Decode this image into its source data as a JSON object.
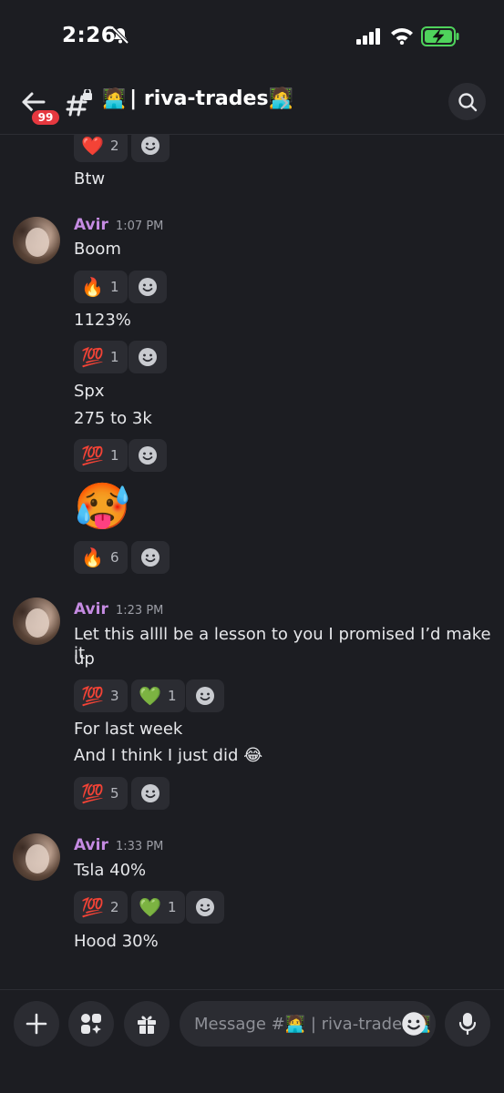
{
  "status_bar": {
    "time": "2:26"
  },
  "header": {
    "unread_count": "99",
    "channel_emoji": "🧑‍💻",
    "channel_name": "| riva-trades🧑‍💻"
  },
  "messages": {
    "pre": {
      "reaction": {
        "emoji": "❤️",
        "count": "2"
      },
      "text": "Btw"
    },
    "group1": {
      "author": "Avir",
      "time": "1:07 PM",
      "lines": [
        "Boom",
        "1123%",
        "Spx",
        "275 to 3k"
      ],
      "big_emoji": "🥵",
      "reactions": [
        {
          "emoji": "🔥",
          "count": "1"
        },
        {
          "emoji": "💯",
          "count": "1"
        },
        {
          "emoji": "💯",
          "count": "1"
        },
        {
          "emoji": "🔥",
          "count": "6"
        }
      ]
    },
    "group2": {
      "author": "Avir",
      "time": "1:23 PM",
      "line1a": "Let this allll be a lesson to you I promised I’d make it",
      "line1b": "up",
      "line2": "For last week",
      "line3": "And I think I just did 😂",
      "reactions_a": [
        {
          "emoji": "💯",
          "count": "3"
        },
        {
          "emoji": "💚",
          "count": "1"
        }
      ],
      "reactions_b": [
        {
          "emoji": "💯",
          "count": "5"
        }
      ]
    },
    "group3": {
      "author": "Avir",
      "time": "1:33 PM",
      "line1": "Tsla 40%",
      "line2": "Hood 30%",
      "reactions": [
        {
          "emoji": "💯",
          "count": "2"
        },
        {
          "emoji": "💚",
          "count": "1"
        }
      ]
    }
  },
  "composer": {
    "placeholder": "Message #🧑‍💻 | riva-trades🧑‍💻"
  }
}
